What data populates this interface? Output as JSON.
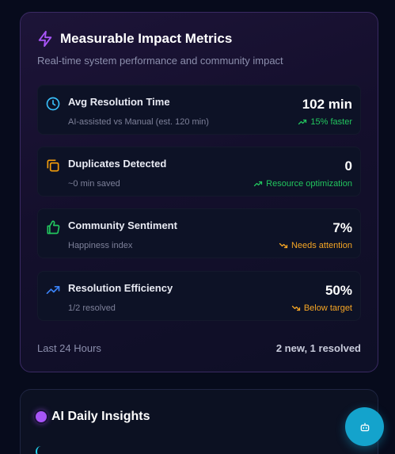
{
  "impact": {
    "title": "Measurable Impact Metrics",
    "subtitle": "Real-time system performance and community impact",
    "metrics": [
      {
        "title": "Avg Resolution Time",
        "desc": "AI-assisted vs Manual (est. 120 min)",
        "value": "102 min",
        "trend": "15% faster",
        "trend_dir": "up",
        "icon": "clock-icon",
        "color": "#38bdf8"
      },
      {
        "title": "Duplicates Detected",
        "desc": "~0 min saved",
        "value": "0",
        "trend": "Resource optimization",
        "trend_dir": "up",
        "icon": "copy-icon",
        "color": "#f59e0b"
      },
      {
        "title": "Community Sentiment",
        "desc": "Happiness index",
        "value": "7%",
        "trend": "Needs attention",
        "trend_dir": "down",
        "icon": "thumbs-up-icon",
        "color": "#22c55e"
      },
      {
        "title": "Resolution Efficiency",
        "desc": "1/2 resolved",
        "value": "50%",
        "trend": "Below target",
        "trend_dir": "down",
        "icon": "trending-up-icon",
        "color": "#3b82f6"
      }
    ],
    "footer_left": "Last 24 Hours",
    "footer_right": "2 new, 1 resolved"
  },
  "insights": {
    "title": "AI Daily Insights"
  },
  "colors": {
    "accent_purple": "#a855f7",
    "trend_up": "#22c55e",
    "trend_down": "#f5a524",
    "fab": "#14a3cc"
  },
  "fab": {
    "icon": "bot-icon"
  }
}
